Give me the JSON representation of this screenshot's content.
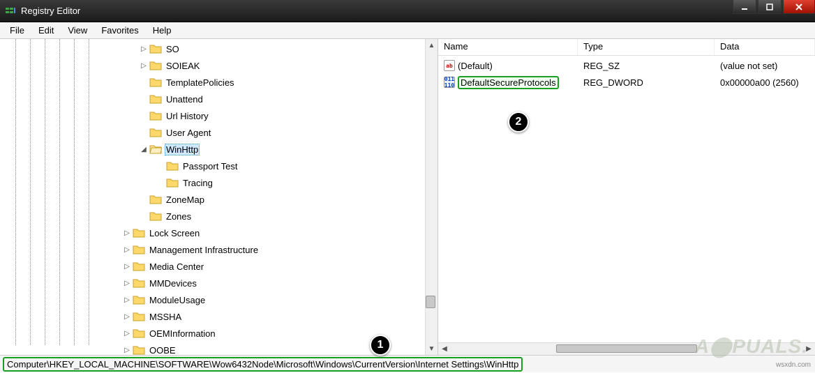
{
  "window": {
    "title": "Registry Editor"
  },
  "menu": {
    "file": "File",
    "edit": "Edit",
    "view": "View",
    "favorites": "Favorites",
    "help": "Help"
  },
  "tree": {
    "selected": "WinHttp",
    "nodes": [
      {
        "indent": 200,
        "expander": "▷",
        "label": "SO"
      },
      {
        "indent": 200,
        "expander": "▷",
        "label": "SOIEAK"
      },
      {
        "indent": 200,
        "expander": "",
        "label": "TemplatePolicies"
      },
      {
        "indent": 200,
        "expander": "",
        "label": "Unattend"
      },
      {
        "indent": 200,
        "expander": "",
        "label": "Url History"
      },
      {
        "indent": 200,
        "expander": "",
        "label": "User Agent"
      },
      {
        "indent": 200,
        "expander": "◢",
        "label": "WinHttp",
        "selected": true
      },
      {
        "indent": 224,
        "expander": "",
        "label": "Passport Test"
      },
      {
        "indent": 224,
        "expander": "",
        "label": "Tracing"
      },
      {
        "indent": 200,
        "expander": "",
        "label": "ZoneMap"
      },
      {
        "indent": 200,
        "expander": "",
        "label": "Zones"
      },
      {
        "indent": 176,
        "expander": "▷",
        "label": "Lock Screen"
      },
      {
        "indent": 176,
        "expander": "▷",
        "label": "Management Infrastructure"
      },
      {
        "indent": 176,
        "expander": "▷",
        "label": "Media Center"
      },
      {
        "indent": 176,
        "expander": "▷",
        "label": "MMDevices"
      },
      {
        "indent": 176,
        "expander": "▷",
        "label": "ModuleUsage"
      },
      {
        "indent": 176,
        "expander": "▷",
        "label": "MSSHA"
      },
      {
        "indent": 176,
        "expander": "▷",
        "label": "OEMInformation"
      },
      {
        "indent": 176,
        "expander": "▷",
        "label": "OOBE"
      }
    ]
  },
  "list": {
    "columns": {
      "name": "Name",
      "type": "Type",
      "data": "Data"
    },
    "rows": [
      {
        "icon": "sz",
        "name": "(Default)",
        "type": "REG_SZ",
        "data": "(value not set)",
        "highlight": false
      },
      {
        "icon": "dw",
        "name": "DefaultSecureProtocols",
        "type": "REG_DWORD",
        "data": "0x00000a00 (2560)",
        "highlight": true
      }
    ]
  },
  "status": {
    "path": "Computer\\HKEY_LOCAL_MACHINE\\SOFTWARE\\Wow6432Node\\Microsoft\\Windows\\CurrentVersion\\Internet Settings\\WinHttp"
  },
  "annotations": {
    "badge1": "1",
    "badge2": "2"
  },
  "watermark": {
    "main": "A⬤PUALS.",
    "sub": "wsxdn.com"
  }
}
